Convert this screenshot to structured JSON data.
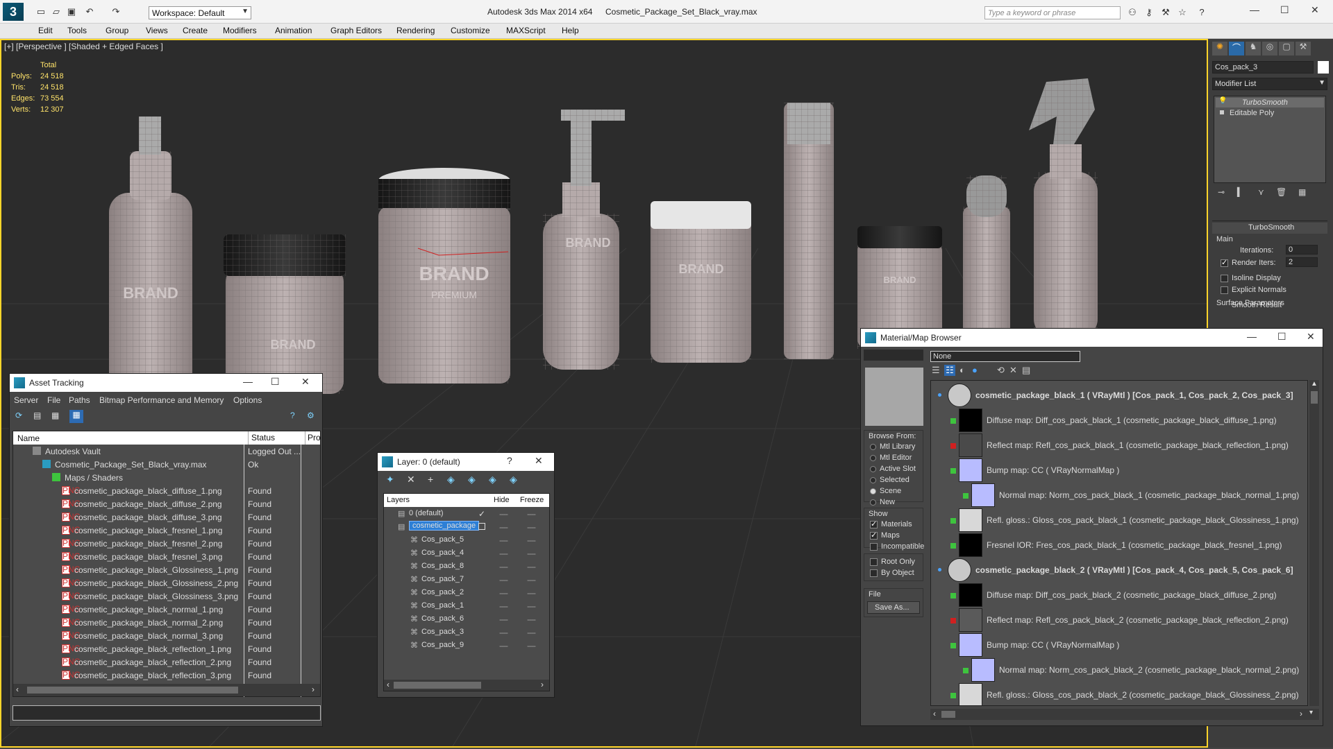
{
  "title_bar": {
    "workspace": "Workspace: Default",
    "app": "Autodesk 3ds Max  2014 x64",
    "file": "Cosmetic_Package_Set_Black_vray.max",
    "search_placeholder": "Type a keyword or phrase"
  },
  "menu": [
    "Edit",
    "Tools",
    "Group",
    "Views",
    "Create",
    "Modifiers",
    "Animation",
    "Graph Editors",
    "Rendering",
    "Customize",
    "MAXScript",
    "Help"
  ],
  "viewport": {
    "label": "[+] [Perspective ] [Shaded + Edged Faces ]",
    "stats": {
      "header": "Total",
      "rows": [
        {
          "k": "Polys:",
          "v": "24 518"
        },
        {
          "k": "Tris:",
          "v": "24 518"
        },
        {
          "k": "Edges:",
          "v": "73 554"
        },
        {
          "k": "Verts:",
          "v": "12 307"
        }
      ]
    },
    "brand": "BRAND",
    "premium": "PREMIUM"
  },
  "command_panel": {
    "object_name": "Cos_pack_3",
    "modifier_list": "Modifier List",
    "stack": [
      "TurboSmooth",
      "Editable Poly"
    ],
    "rollout": "TurboSmooth",
    "main": "Main",
    "iterations_label": "Iterations:",
    "iterations": "0",
    "render_iters_label": "Render Iters:",
    "render_iters": "2",
    "isoline": "Isoline Display",
    "explicit": "Explicit Normals",
    "surface": "Surface Parameters",
    "smooth": "Smooth Result"
  },
  "asset_tracking": {
    "title": "Asset Tracking",
    "menu": [
      "Server",
      "File",
      "Paths",
      "Bitmap Performance and Memory",
      "Options"
    ],
    "columns": [
      "Name",
      "Status",
      "Pro"
    ],
    "rows": [
      {
        "name": "Autodesk Vault",
        "status": "Logged Out ...",
        "indent": 0
      },
      {
        "name": "Cosmetic_Package_Set_Black_vray.max",
        "status": "Ok",
        "indent": 1
      },
      {
        "name": "Maps / Shaders",
        "status": "",
        "indent": 2
      },
      {
        "name": "cosmetic_package_black_diffuse_1.png",
        "status": "Found",
        "indent": 3
      },
      {
        "name": "cosmetic_package_black_diffuse_2.png",
        "status": "Found",
        "indent": 3
      },
      {
        "name": "cosmetic_package_black_diffuse_3.png",
        "status": "Found",
        "indent": 3
      },
      {
        "name": "cosmetic_package_black_fresnel_1.png",
        "status": "Found",
        "indent": 3
      },
      {
        "name": "cosmetic_package_black_fresnel_2.png",
        "status": "Found",
        "indent": 3
      },
      {
        "name": "cosmetic_package_black_fresnel_3.png",
        "status": "Found",
        "indent": 3
      },
      {
        "name": "cosmetic_package_black_Glossiness_1.png",
        "status": "Found",
        "indent": 3
      },
      {
        "name": "cosmetic_package_black_Glossiness_2.png",
        "status": "Found",
        "indent": 3
      },
      {
        "name": "cosmetic_package_black_Glossiness_3.png",
        "status": "Found",
        "indent": 3
      },
      {
        "name": "cosmetic_package_black_normal_1.png",
        "status": "Found",
        "indent": 3
      },
      {
        "name": "cosmetic_package_black_normal_2.png",
        "status": "Found",
        "indent": 3
      },
      {
        "name": "cosmetic_package_black_normal_3.png",
        "status": "Found",
        "indent": 3
      },
      {
        "name": "cosmetic_package_black_reflection_1.png",
        "status": "Found",
        "indent": 3
      },
      {
        "name": "cosmetic_package_black_reflection_2.png",
        "status": "Found",
        "indent": 3
      },
      {
        "name": "cosmetic_package_black_reflection_3.png",
        "status": "Found",
        "indent": 3
      }
    ]
  },
  "layer_dialog": {
    "title": "Layer: 0 (default)",
    "columns": [
      "Layers",
      "Hide",
      "Freeze"
    ],
    "layers": [
      {
        "name": "0 (default)",
        "sel": false,
        "indent": 0
      },
      {
        "name": "cosmetic_package",
        "sel": true,
        "indent": 0
      },
      {
        "name": "Cos_pack_5",
        "sel": false,
        "indent": 1
      },
      {
        "name": "Cos_pack_4",
        "sel": false,
        "indent": 1
      },
      {
        "name": "Cos_pack_8",
        "sel": false,
        "indent": 1
      },
      {
        "name": "Cos_pack_7",
        "sel": false,
        "indent": 1
      },
      {
        "name": "Cos_pack_2",
        "sel": false,
        "indent": 1
      },
      {
        "name": "Cos_pack_1",
        "sel": false,
        "indent": 1
      },
      {
        "name": "Cos_pack_6",
        "sel": false,
        "indent": 1
      },
      {
        "name": "Cos_pack_3",
        "sel": false,
        "indent": 1
      },
      {
        "name": "Cos_pack_9",
        "sel": false,
        "indent": 1
      }
    ]
  },
  "material_browser": {
    "title": "Material/Map Browser",
    "search_value": "None",
    "browse_from": "Browse From:",
    "browse_options": [
      "Mtl Library",
      "Mtl Editor",
      "Active Slot",
      "Selected",
      "Scene",
      "New"
    ],
    "browse_selected": "Scene",
    "show": "Show",
    "show_options": [
      {
        "label": "Materials",
        "on": true
      },
      {
        "label": "Maps",
        "on": true
      },
      {
        "label": "Incompatible",
        "on": false
      }
    ],
    "extra_options": [
      {
        "label": "Root Only",
        "on": false
      },
      {
        "label": "By Object",
        "on": false
      }
    ],
    "file": "File",
    "save_as": "Save As...",
    "entries": [
      {
        "kind": "mat",
        "text": "cosmetic_package_black_1  ( VRayMtl ) [Cos_pack_1, Cos_pack_2, Cos_pack_3]",
        "swatch": "#c8c8c8",
        "mark": ""
      },
      {
        "kind": "map",
        "text": "Diffuse map: Diff_cos_pack_black_1 (cosmetic_package_black_diffuse_1.png)",
        "swatch": "#000000",
        "mark": "green"
      },
      {
        "kind": "map",
        "text": "Reflect map: Refl_cos_pack_black_1 (cosmetic_package_black_reflection_1.png)",
        "swatch": "#4a4a4a",
        "mark": "red"
      },
      {
        "kind": "map",
        "text": "Bump map: CC  ( VRayNormalMap )",
        "swatch": "#b8bcff",
        "mark": "green"
      },
      {
        "kind": "sub",
        "text": "Normal map: Norm_cos_pack_black_1 (cosmetic_package_black_normal_1.png)",
        "swatch": "#b8bcff",
        "mark": "green"
      },
      {
        "kind": "map",
        "text": "Refl. gloss.: Gloss_cos_pack_black_1 (cosmetic_package_black_Glossiness_1.png)",
        "swatch": "#d8d8d8",
        "mark": "green"
      },
      {
        "kind": "map",
        "text": "Fresnel IOR: Fres_cos_pack_black_1 (cosmetic_package_black_fresnel_1.png)",
        "swatch": "#000000",
        "mark": "green"
      },
      {
        "kind": "mat",
        "text": "cosmetic_package_black_2  ( VRayMtl ) [Cos_pack_4, Cos_pack_5, Cos_pack_6]",
        "swatch": "#c8c8c8",
        "mark": ""
      },
      {
        "kind": "map",
        "text": "Diffuse map: Diff_cos_pack_black_2 (cosmetic_package_black_diffuse_2.png)",
        "swatch": "#000000",
        "mark": "green"
      },
      {
        "kind": "map",
        "text": "Reflect map: Refl_cos_pack_black_2 (cosmetic_package_black_reflection_2.png)",
        "swatch": "#5a5a5a",
        "mark": "red"
      },
      {
        "kind": "map",
        "text": "Bump map: CC  ( VRayNormalMap )",
        "swatch": "#b8bcff",
        "mark": "green"
      },
      {
        "kind": "sub",
        "text": "Normal map: Norm_cos_pack_black_2 (cosmetic_package_black_normal_2.png)",
        "swatch": "#b8bcff",
        "mark": "green"
      },
      {
        "kind": "map",
        "text": "Refl. gloss.: Gloss_cos_pack_black_2 (cosmetic_package_black_Glossiness_2.png)",
        "swatch": "#d8d8d8",
        "mark": "green"
      }
    ]
  },
  "colors": {
    "accent": "#ffd52a",
    "select": "#2d7fd6",
    "found": "#dddddd"
  }
}
